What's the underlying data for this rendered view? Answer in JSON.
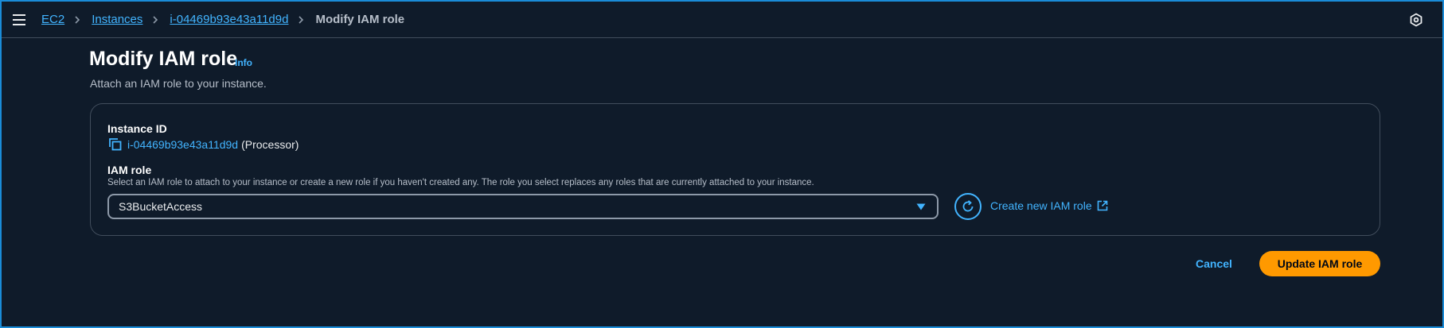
{
  "breadcrumb": {
    "items": [
      {
        "label": "EC2"
      },
      {
        "label": "Instances"
      },
      {
        "label": "i-04469b93e43a11d9d"
      }
    ],
    "current": "Modify IAM role"
  },
  "page": {
    "title": "Modify IAM role",
    "info_label": "Info",
    "subtitle": "Attach an IAM role to your instance."
  },
  "form": {
    "instance_id_label": "Instance ID",
    "instance_id": "i-04469b93e43a11d9d",
    "instance_name": "(Processor)",
    "iam_role_label": "IAM role",
    "iam_role_description": "Select an IAM role to attach to your instance or create a new role if you haven't created any. The role you select replaces any roles that are currently attached to your instance.",
    "iam_role_selected": "S3BucketAccess",
    "create_role_label": "Create new IAM role"
  },
  "actions": {
    "cancel_label": "Cancel",
    "submit_label": "Update IAM role"
  },
  "icons": {
    "menu": "hamburger-menu-icon",
    "settings": "settings-hexagon-icon",
    "copy": "copy-icon",
    "refresh": "refresh-icon",
    "external": "external-link-icon",
    "caret": "caret-down-icon"
  },
  "colors": {
    "background": "#0f1b2a",
    "link": "#42b4ff",
    "primary_button": "#ff9900",
    "border": "#414d5c",
    "frame_border": "#1a8cd8"
  }
}
